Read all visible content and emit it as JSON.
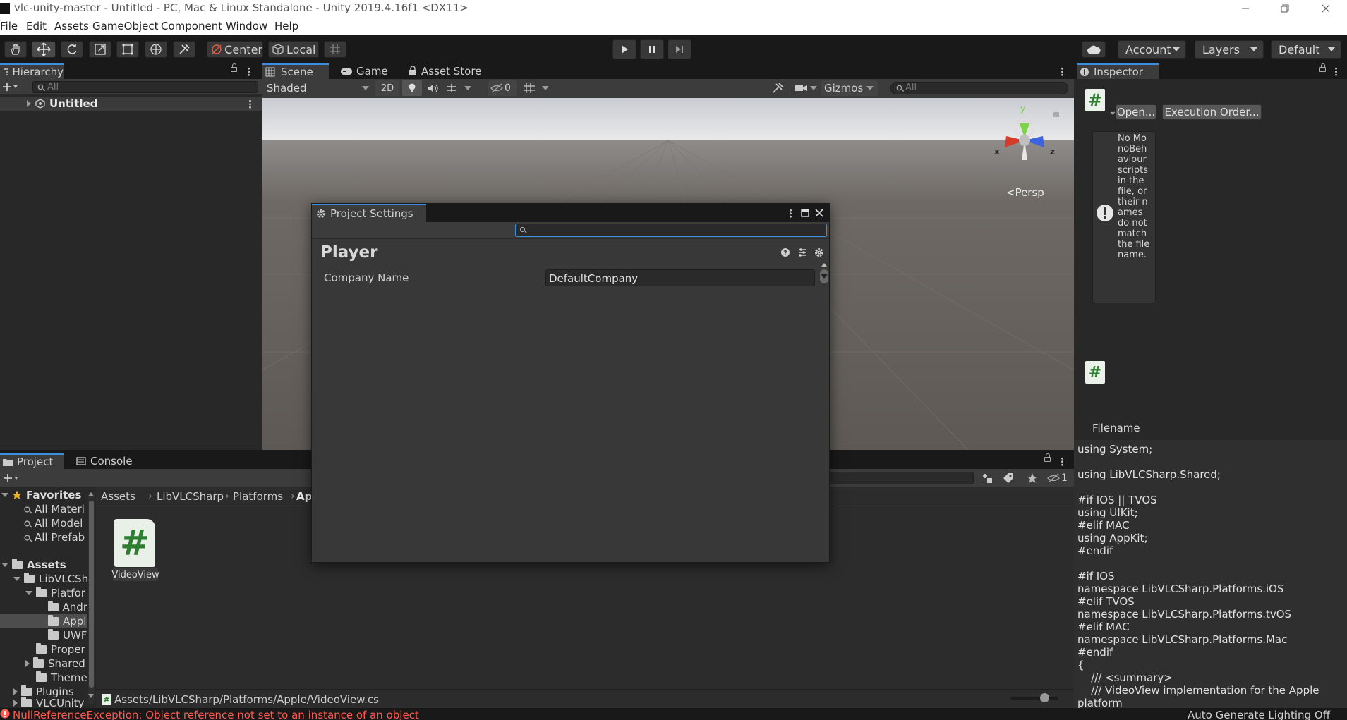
{
  "window": {
    "title": "vlc-unity-master - Untitled - PC, Mac & Linux Standalone - Unity 2019.4.16f1 <DX11>",
    "minimize_icon": "minimize-icon",
    "maximize_icon": "restore-icon",
    "close_icon": "close-icon"
  },
  "menu": [
    "File",
    "Edit",
    "Assets",
    "GameObject",
    "Component",
    "Window",
    "Help"
  ],
  "toolbar": {
    "pivot_label": "Center",
    "space_label": "Local",
    "account_label": "Account",
    "layers_label": "Layers",
    "layout_label": "Default"
  },
  "hierarchy": {
    "tab_label": "Hierarchy",
    "search_placeholder": "All",
    "scene_name": "Untitled"
  },
  "scene_view": {
    "tabs": [
      "Scene",
      "Game",
      "Asset Store"
    ],
    "shading_mode": "Shaded",
    "mode_2d": "2D",
    "hidden_count": "0",
    "gizmos_label": "Gizmos",
    "search_placeholder": "All",
    "persp_label": "<Persp",
    "axis_x": "x",
    "axis_y": "y",
    "axis_z": "z"
  },
  "project_settings": {
    "title": "Project Settings",
    "search_value": "",
    "heading": "Player",
    "field_label": "Company Name",
    "field_value": "DefaultCompany"
  },
  "inspector": {
    "tab_label": "Inspector",
    "open_button": "Open...",
    "execution_order_button": "Execution Order...",
    "warning_text": "No MonoBehaviour scripts in the file, or their names do not match the file name.",
    "filename_label": "Filename",
    "code": "using System;\n\nusing LibVLCSharp.Shared;\n\n#if IOS || TVOS\nusing UIKit;\n#elif MAC\nusing AppKit;\n#endif\n\n#if IOS\nnamespace LibVLCSharp.Platforms.iOS\n#elif TVOS\nnamespace LibVLCSharp.Platforms.tvOS\n#elif MAC\nnamespace LibVLCSharp.Platforms.Mac\n#endif\n{\n    /// <summary>\n    /// VideoView implementation for the Apple\nplatform"
  },
  "project": {
    "tabs": [
      "Project",
      "Console"
    ],
    "hidden_count": "1",
    "favorites_label": "Favorites",
    "favorites": [
      "All Materi",
      "All Model",
      "All Prefab"
    ],
    "assets_label": "Assets",
    "tree": [
      {
        "label": "LibVLCSh",
        "depth": 1,
        "expand": "down"
      },
      {
        "label": "Platfor",
        "depth": 2,
        "expand": "down"
      },
      {
        "label": "Andr",
        "depth": 3,
        "expand": "none"
      },
      {
        "label": "Appl",
        "depth": 3,
        "expand": "none",
        "selected": true
      },
      {
        "label": "UWF",
        "depth": 3,
        "expand": "none"
      },
      {
        "label": "Proper",
        "depth": 2,
        "expand": "none"
      },
      {
        "label": "Shared",
        "depth": 2,
        "expand": "right"
      },
      {
        "label": "Theme",
        "depth": 2,
        "expand": "none"
      },
      {
        "label": "Plugins",
        "depth": 1,
        "expand": "right"
      },
      {
        "label": "VLCUnity",
        "depth": 1,
        "expand": "right"
      }
    ],
    "breadcrumb": [
      "Assets",
      "LibVLCSharp",
      "Platforms",
      "Ap"
    ],
    "asset_name": "VideoView",
    "asset_glyph": "#",
    "path": "Assets/LibVLCSharp/Platforms/Apple/VideoView.cs",
    "zoom_slider": 0.7
  },
  "status": {
    "error_text": "NullReferenceException: Object reference not set to an instance of an object",
    "lighting_text": "Auto Generate Lighting Off"
  },
  "colors": {
    "accent": "#3b8ee0",
    "error": "#ff5a50",
    "script_icon_bg": "#e8f0e8",
    "script_icon_hash": "#2e7d32"
  }
}
